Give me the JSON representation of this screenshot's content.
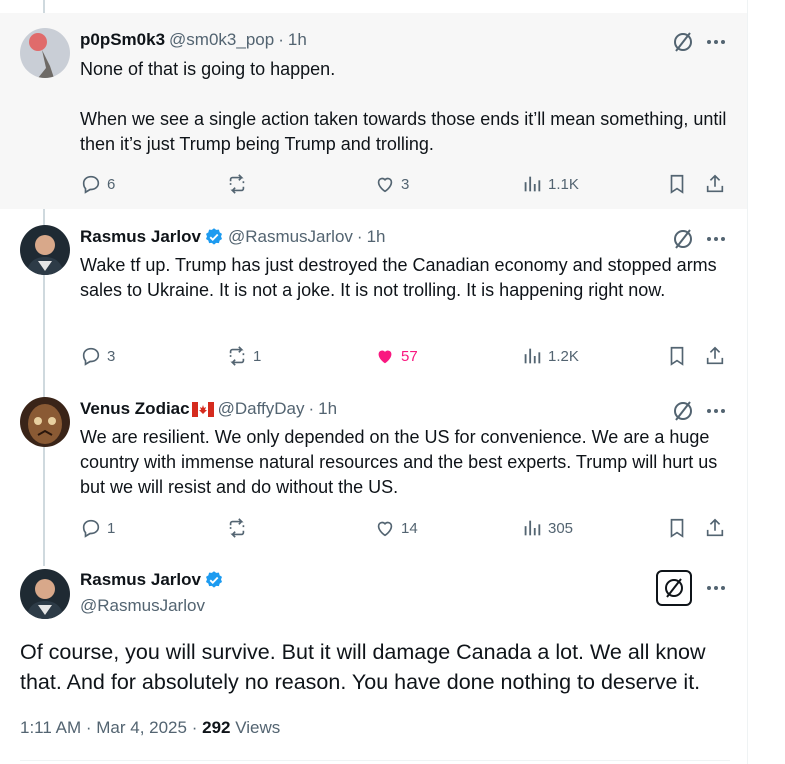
{
  "replies": [
    {
      "name": "p0pSm0k3",
      "handle": "@sm0k3_pop",
      "time": "1h",
      "text": [
        "None of that is going to happen.",
        "When we see a single action taken towards those ends it’ll mean something, until then it’s just Trump being Trump and trolling."
      ],
      "replies": "6",
      "reposts": "",
      "likes": "3",
      "views": "1.1K",
      "liked": false
    },
    {
      "name": "Rasmus Jarlov",
      "handle": "@RasmusJarlov",
      "time": "1h",
      "verified": true,
      "text": [
        "Wake tf up. Trump has just destroyed the Canadian economy and stopped arms sales to Ukraine. It is not a joke. It is not trolling. It is happening right now."
      ],
      "replies": "3",
      "reposts": "1",
      "likes": "57",
      "views": "1.2K",
      "liked": true
    },
    {
      "name": "Venus Zodiac",
      "handle": "@DaffyDay",
      "time": "1h",
      "flag": "canada-flag",
      "text": [
        "We are resilient. We only depended on the US for convenience. We are a huge country with immense natural resources and the best experts. Trump will hurt us but we will resist and do without the US."
      ],
      "replies": "1",
      "reposts": "",
      "likes": "14",
      "views": "305",
      "liked": false
    }
  ],
  "main": {
    "name": "Rasmus Jarlov",
    "handle": "@RasmusJarlov",
    "text": "Of course, you will survive. But it will damage Canada a lot. We all know that. And for absolutely no reason. You have done nothing to deserve it.",
    "time": "1:11 AM",
    "date": "Mar 4, 2025",
    "views_count": "292",
    "views_label": "Views"
  },
  "colors": {
    "accent": "#1d9bf0",
    "like": "#f91880",
    "muted": "#536471",
    "text": "#0f1419",
    "highlight_bg": "#f7f7f7"
  },
  "icons": [
    "reply-icon",
    "repost-icon",
    "like-icon",
    "views-icon",
    "bookmark-icon",
    "share-icon",
    "grok-icon",
    "more-icon",
    "verified-badge-icon"
  ]
}
